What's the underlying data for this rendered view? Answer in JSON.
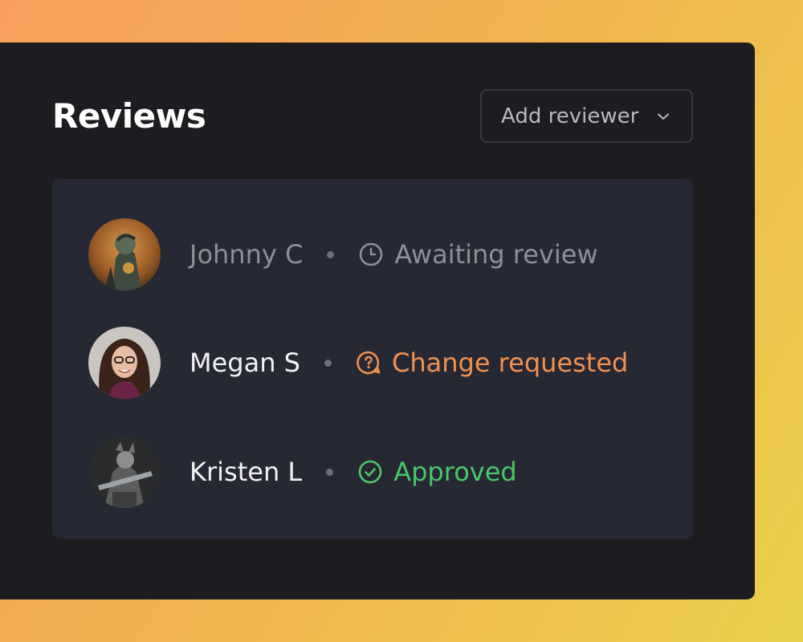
{
  "header": {
    "title": "Reviews",
    "add_reviewer_label": "Add reviewer",
    "chevron_icon": "chevron-down-icon"
  },
  "colors": {
    "panel_bg": "#1c1c21",
    "card_bg": "#262834",
    "muted_text": "#8e8f9a",
    "white_text": "#f2f2f4",
    "awaiting": "#8e8f9a",
    "change_requested": "#f2914f",
    "approved": "#49c766"
  },
  "reviewers": [
    {
      "name": "Johnny C",
      "status": "Awaiting review",
      "status_icon": "clock-icon",
      "status_color": "#8e8f9a",
      "name_color": "#8e8f9a"
    },
    {
      "name": "Megan S",
      "status": "Change requested",
      "status_icon": "question-bubble-icon",
      "status_color": "#f2914f",
      "name_color": "#f2f2f4"
    },
    {
      "name": "Kristen L",
      "status": "Approved",
      "status_icon": "check-circle-icon",
      "status_color": "#49c766",
      "name_color": "#f2f2f4"
    }
  ]
}
